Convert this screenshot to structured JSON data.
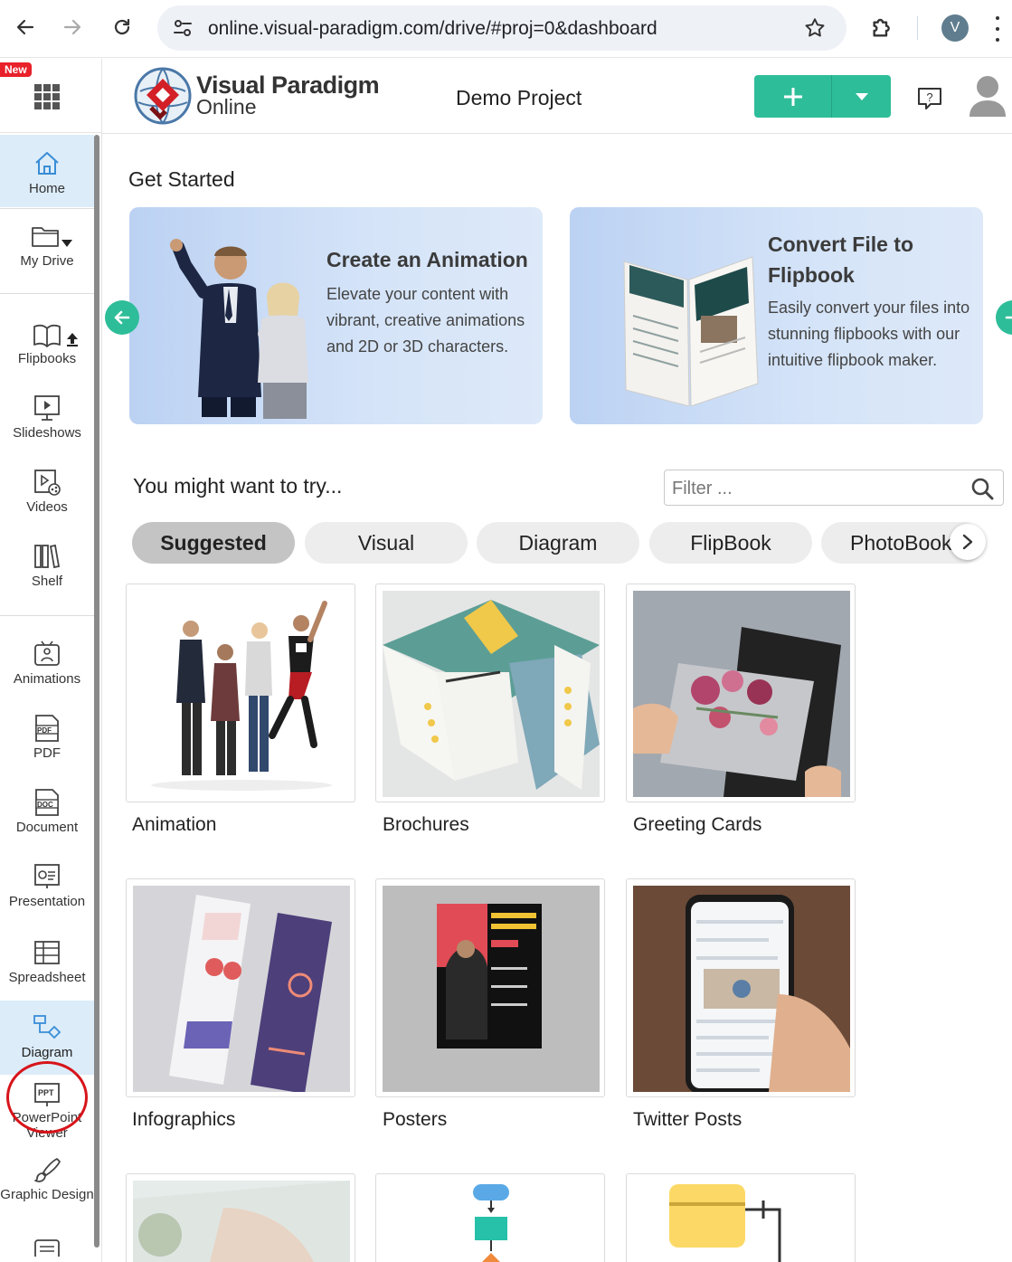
{
  "browser": {
    "url": "online.visual-paradigm.com/drive/#proj=0&dashboard",
    "profile_initial": "V"
  },
  "sidebar": {
    "new_badge": "New",
    "items": [
      {
        "label": "Home",
        "icon": "home-icon",
        "active": true
      },
      {
        "label": "My Drive",
        "icon": "folder-icon"
      },
      {
        "label": "Flipbooks",
        "icon": "book-icon"
      },
      {
        "label": "Slideshows",
        "icon": "slideshow-icon"
      },
      {
        "label": "Videos",
        "icon": "video-icon"
      },
      {
        "label": "Shelf",
        "icon": "shelf-icon"
      },
      {
        "label": "Animations",
        "icon": "animation-icon"
      },
      {
        "label": "PDF",
        "icon": "pdf-icon"
      },
      {
        "label": "Document",
        "icon": "doc-icon"
      },
      {
        "label": "Presentation",
        "icon": "presentation-icon"
      },
      {
        "label": "Spreadsheet",
        "icon": "spreadsheet-icon"
      },
      {
        "label": "Diagram",
        "icon": "diagram-icon",
        "highlighted": true
      },
      {
        "label": "PowerPoint Viewer",
        "icon": "ppt-icon"
      },
      {
        "label": "Graphic Design",
        "icon": "brush-icon"
      }
    ],
    "pdf_tag": "PDF",
    "doc_tag": "DOC",
    "ppt_tag": "PPT"
  },
  "header": {
    "logo_line1": "Visual Paradigm",
    "logo_line2": "Online",
    "project_title": "Demo Project",
    "add_label": "+",
    "accent": "#2ebd99"
  },
  "main": {
    "get_started": "Get Started",
    "promos": [
      {
        "title": "Create an Animation",
        "body": "Elevate your content with vibrant, creative animations and 2D or 3D characters."
      },
      {
        "title": "Convert File to Flipbook",
        "body": "Easily convert your files into stunning flipbooks with our intuitive flipbook maker."
      }
    ],
    "try_title": "You might want to try...",
    "filter_placeholder": "Filter ...",
    "tabs": [
      "Suggested",
      "Visual",
      "Diagram",
      "FlipBook",
      "PhotoBook"
    ],
    "active_tab": "Suggested",
    "cards": [
      {
        "label": "Animation"
      },
      {
        "label": "Brochures"
      },
      {
        "label": "Greeting Cards"
      },
      {
        "label": "Infographics"
      },
      {
        "label": "Posters"
      },
      {
        "label": "Twitter Posts"
      }
    ]
  }
}
